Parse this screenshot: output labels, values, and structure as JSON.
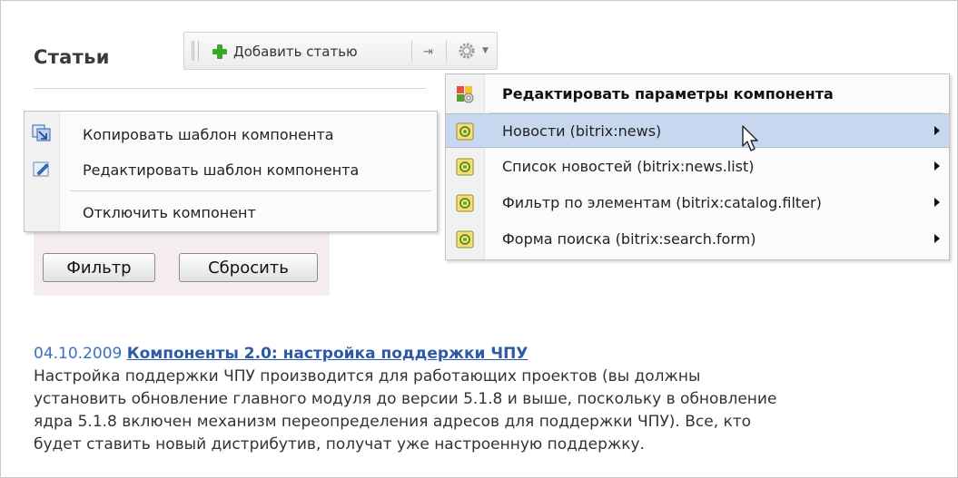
{
  "page": {
    "title": "Статьи"
  },
  "toolbar": {
    "add_label": "Добавить статью"
  },
  "left_menu": {
    "items": [
      {
        "label": "Копировать шаблон компонента"
      },
      {
        "label": "Редактировать шаблон компонента"
      },
      {
        "label": "Отключить компонент"
      }
    ]
  },
  "filter": {
    "filter_label": "Фильтр",
    "reset_label": "Сбросить"
  },
  "right_menu": {
    "items": [
      {
        "label": "Редактировать параметры компонента"
      },
      {
        "label": "Новости (bitrix:news)"
      },
      {
        "label": "Список новостей (bitrix:news.list)"
      },
      {
        "label": "Фильтр по элементам (bitrix:catalog.filter)"
      },
      {
        "label": "Форма поиска (bitrix:search.form)"
      }
    ]
  },
  "news": {
    "date": "04.10.2009",
    "title": "Компоненты 2.0: настройка поддержки ЧПУ",
    "lines": [
      "Настройка поддержки ЧПУ производится для работающих проектов (вы должны",
      "установить обновление главного модуля до версии 5.1.8 и выше, поскольку в обновление",
      "ядра 5.1.8 включен механизм переопределения адресов для поддержки ЧПУ). Все, кто",
      "будет ставить новый дистрибутив, получат уже настроенную поддержку."
    ]
  },
  "colors": {
    "accent_link": "#2c58a8",
    "hover_row": "#c7d7ef",
    "add_green": "#3aa52a"
  },
  "icons": [
    "plus-icon",
    "pin-icon",
    "gear-icon",
    "copy-template-icon",
    "edit-template-icon",
    "component-settings-icon",
    "component-icon",
    "submenu-arrow-icon",
    "mouse-cursor-icon"
  ]
}
